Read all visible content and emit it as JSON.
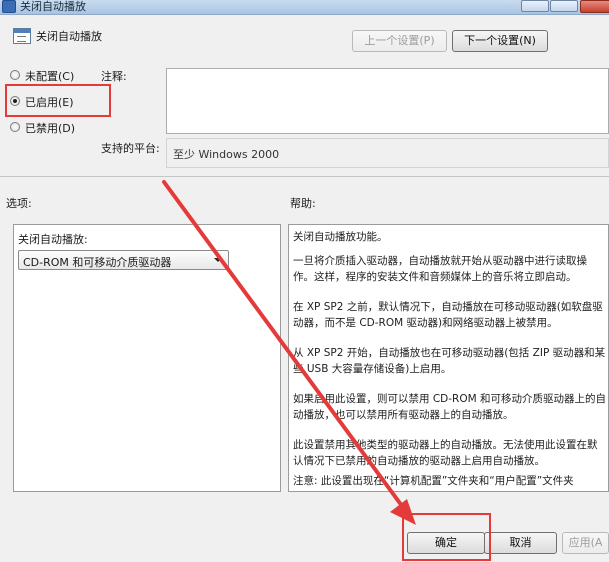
{
  "window": {
    "title": "关闭自动播放"
  },
  "header": {
    "title": "关闭自动播放",
    "prev_button": "上一个设置(P)",
    "next_button": "下一个设置(N)"
  },
  "state_options": [
    {
      "label": "未配置(C)",
      "checked": false
    },
    {
      "label": "已启用(E)",
      "checked": true
    },
    {
      "label": "已禁用(D)",
      "checked": false
    }
  ],
  "comment_label": "注释:",
  "platform_label": "支持的平台:",
  "platform_value": "至少 Windows 2000",
  "options_label": "选项:",
  "help_label": "帮助:",
  "options_panel": {
    "label": "关闭自动播放:",
    "dropdown_value": "CD-ROM 和可移动介质驱动器"
  },
  "help_paragraphs": [
    "关闭自动播放功能。",
    "一旦将介质插入驱动器，自动播放就开始从驱动器中进行读取操作。这样，程序的安装文件和音频媒体上的音乐将立即启动。",
    "在 XP SP2 之前，默认情况下，自动播放在可移动驱动器(如软盘驱动器，而不是 CD-ROM 驱动器)和网络驱动器上被禁用。",
    "从 XP SP2 开始，自动播放也在可移动驱动器(包括 ZIP 驱动器和某些 USB 大容量存储设备)上启用。",
    "如果启用此设置，则可以禁用 CD-ROM 和可移动介质驱动器上的自动播放，也可以禁用所有驱动器上的自动播放。",
    "此设置禁用其他类型的驱动器上的自动播放。无法使用此设置在默认情况下已禁用的自动播放的驱动器上启用自动播放。",
    "注意: 此设置出现在“计算机配置”文件夹和“用户配置”文件夹"
  ],
  "footer": {
    "ok": "确定",
    "cancel": "取消",
    "apply": "应用(A"
  },
  "colors": {
    "annotation": "#e53a3a",
    "window_bg": "#f0f0f0"
  }
}
